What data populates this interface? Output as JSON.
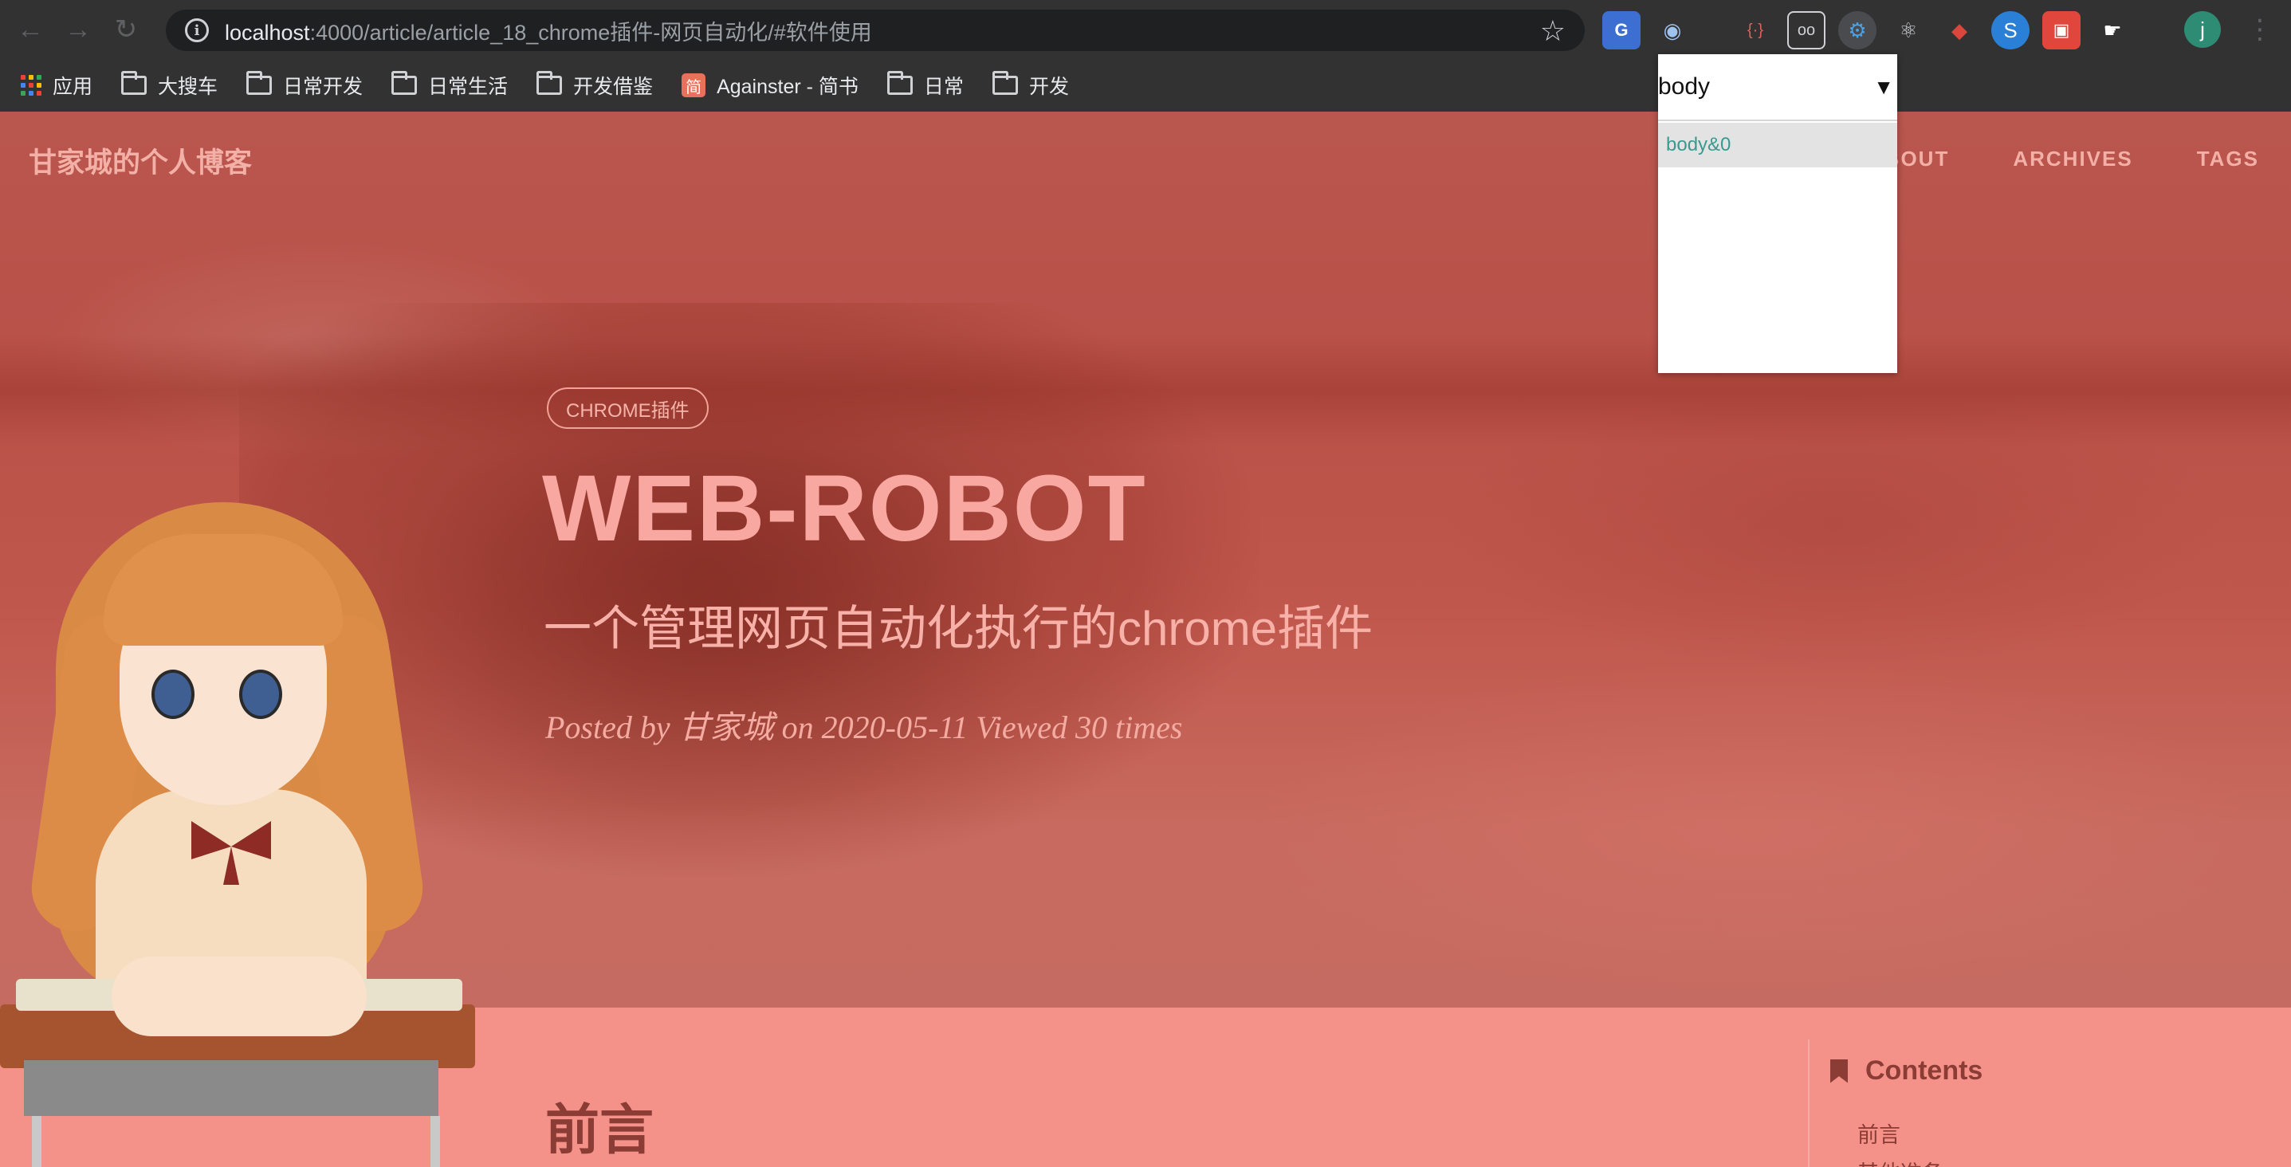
{
  "browser": {
    "url_host": "localhost",
    "url_rest": ":4000/article/article_18_chrome插件-网页自动化/#软件使用",
    "profile_initial": "j",
    "extensions": [
      {
        "name": "google-translate-icon",
        "glyph": "G"
      },
      {
        "name": "circle-extension-icon",
        "glyph": "◉"
      },
      {
        "name": "bracket-extension-icon",
        "glyph": "{·}"
      },
      {
        "name": "glasses-extension-icon",
        "glyph": "oo"
      },
      {
        "name": "robot-extension-icon",
        "glyph": "⚙"
      },
      {
        "name": "react-devtools-icon",
        "glyph": "⚛"
      },
      {
        "name": "shield-extension-icon",
        "glyph": "◆"
      },
      {
        "name": "swirl-extension-icon",
        "glyph": "S"
      },
      {
        "name": "gift-extension-icon",
        "glyph": "▣"
      },
      {
        "name": "hand-extension-icon",
        "glyph": "☛"
      }
    ]
  },
  "bookmarks": [
    {
      "label": "应用",
      "icon": "apps-icon"
    },
    {
      "label": "大搜车",
      "icon": "folder-icon"
    },
    {
      "label": "日常开发",
      "icon": "folder-icon"
    },
    {
      "label": "日常生活",
      "icon": "folder-icon"
    },
    {
      "label": "开发借鉴",
      "icon": "folder-icon"
    },
    {
      "label": "Againster - 简书",
      "icon": "jianshu-icon"
    },
    {
      "label": "日常",
      "icon": "folder-icon"
    },
    {
      "label": "开发",
      "icon": "folder-icon"
    }
  ],
  "site": {
    "title": "甘家城的个人博客",
    "nav": [
      "ABOUT",
      "ARCHIVES",
      "TAGS"
    ]
  },
  "hero": {
    "tag": "CHROME插件",
    "title": "WEB-ROBOT",
    "subtitle": "一个管理网页自动化执行的chrome插件",
    "meta": "Posted by 甘家城 on 2020-05-11 Viewed 30 times"
  },
  "content": {
    "heading": "前言",
    "toc_title": "Contents",
    "toc_items": [
      "前言",
      "其他准备"
    ]
  },
  "popup": {
    "select_value": "body",
    "items": [
      "body&0"
    ]
  },
  "colors": {
    "hero_bg": "#b9564e",
    "content_bg": "#f4928a",
    "accent_text": "#f8a8a0",
    "dark_text": "#8a3c35"
  }
}
